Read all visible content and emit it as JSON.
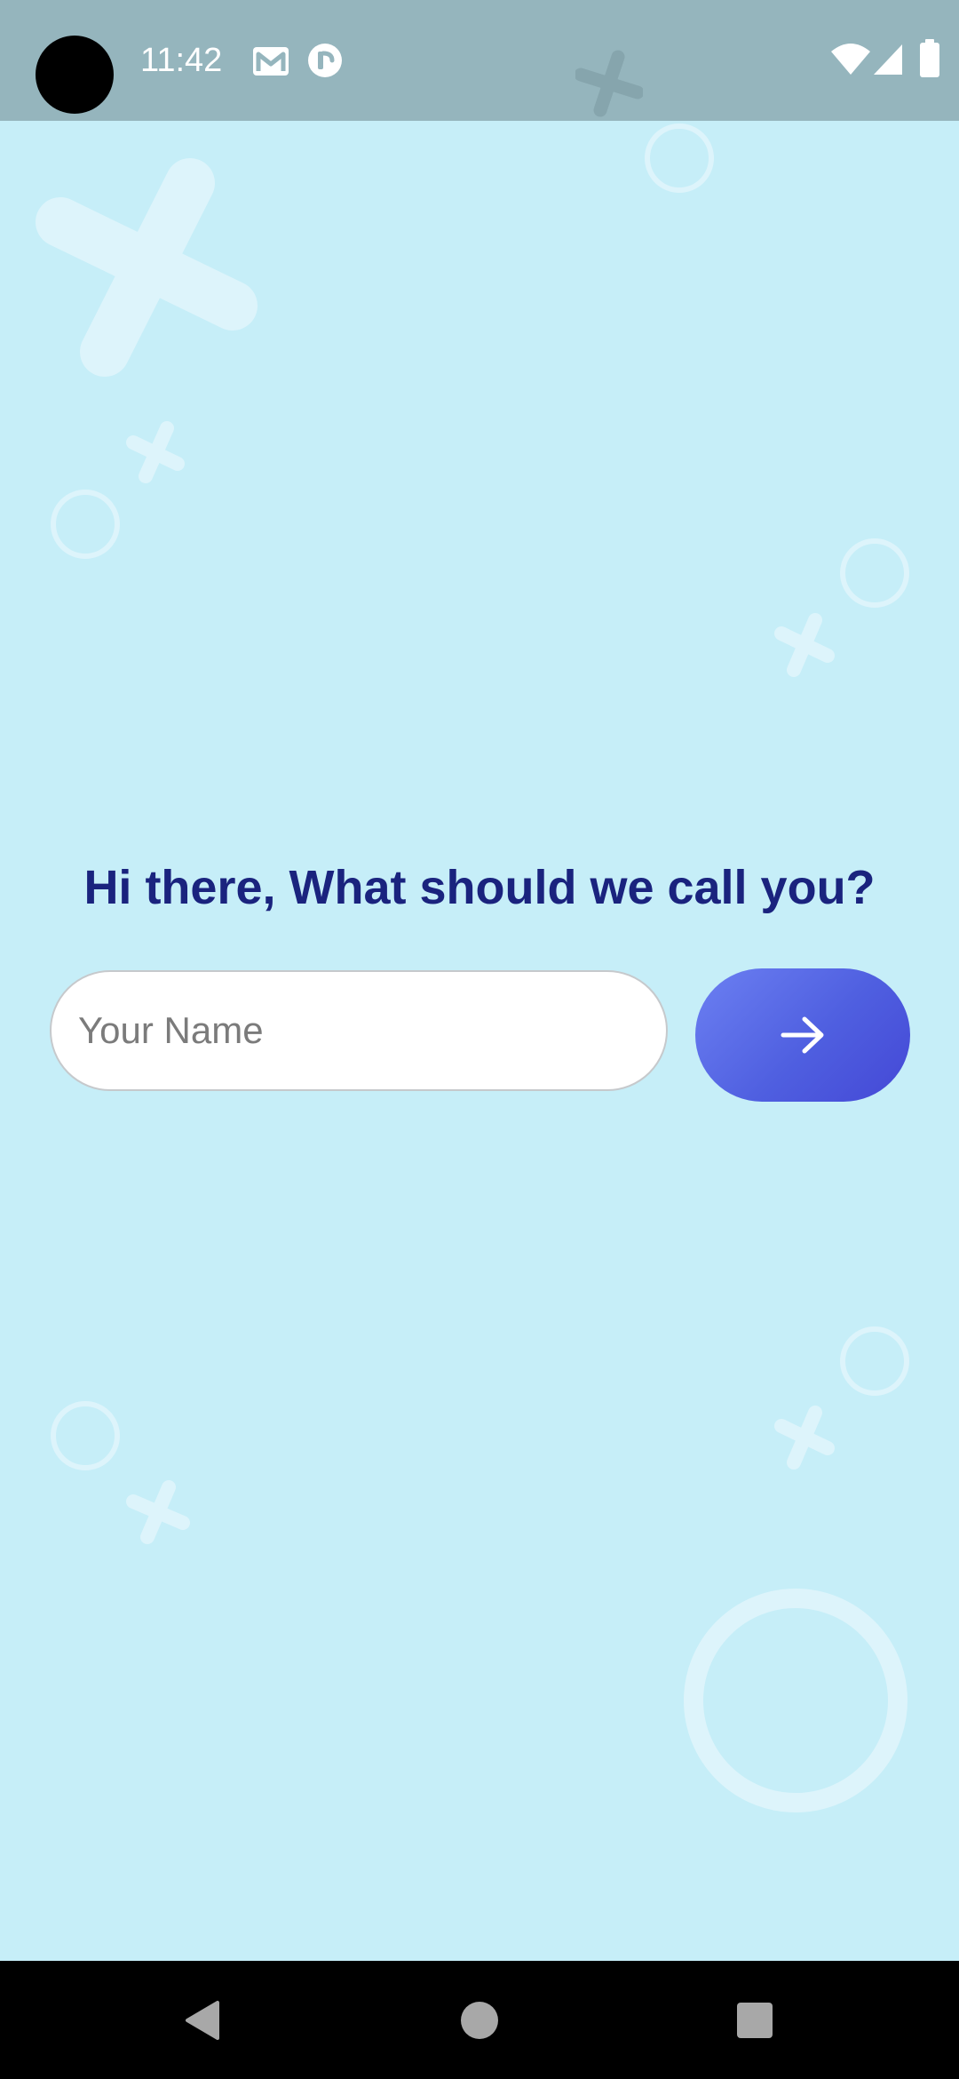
{
  "status_bar": {
    "time": "11:42",
    "notification_icons": [
      "gmail-icon",
      "app-notification-icon"
    ],
    "system_icons": [
      "wifi-icon",
      "cellular-signal-icon",
      "battery-icon"
    ]
  },
  "onboarding": {
    "prompt": "Hi there, What should we call you?",
    "name_field": {
      "placeholder": "Your Name",
      "value": ""
    },
    "next_button_icon": "arrow-right-icon"
  },
  "nav_bar": {
    "buttons": [
      "back-icon",
      "home-icon",
      "recents-icon"
    ]
  },
  "colors": {
    "background": "#c6eef8",
    "status_bar": "#95b5bd",
    "heading": "#1a237e",
    "button_gradient_start": "#6c80f2",
    "button_gradient_end": "#4448d6"
  }
}
